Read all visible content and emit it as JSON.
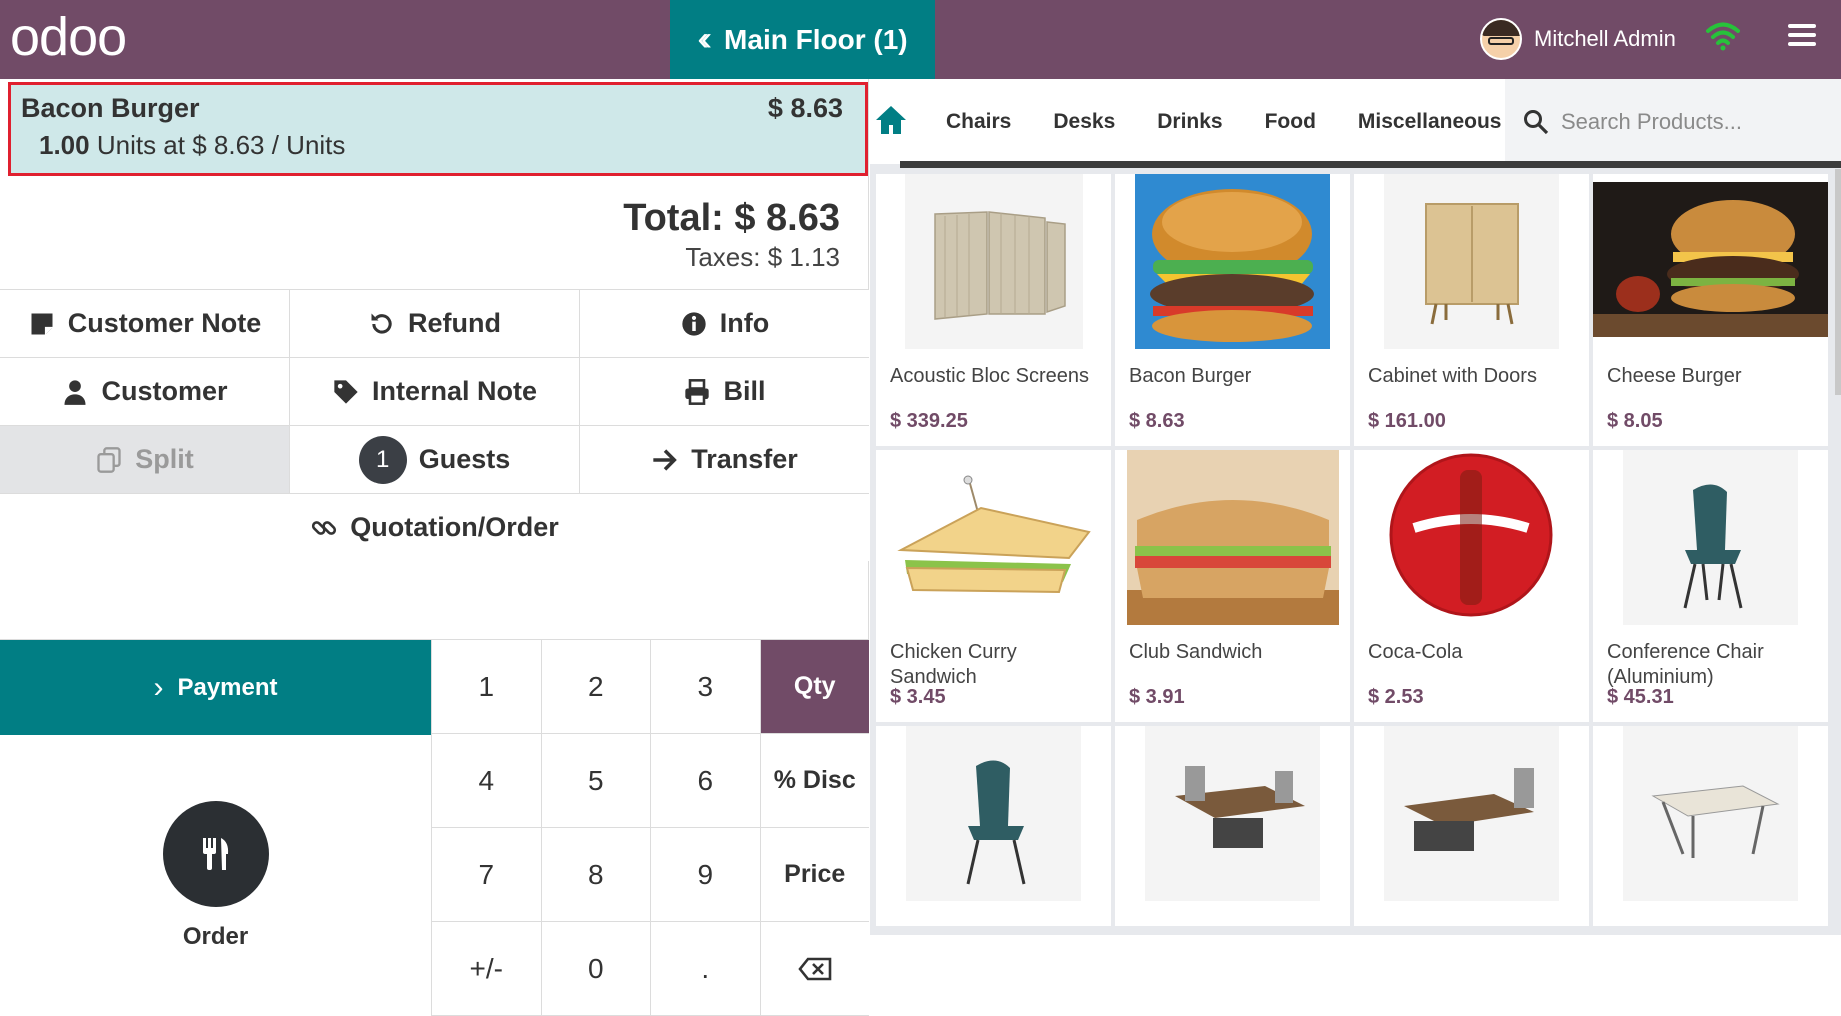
{
  "topbar": {
    "logo": "odoo",
    "floor_button": "Main Floor (1)",
    "user_name": "Mitchell Admin",
    "colors": {
      "brand": "#714B67",
      "teal": "#017E84"
    }
  },
  "order": {
    "line": {
      "name": "Bacon Burger",
      "price": "$ 8.63",
      "qty": "1.00",
      "qty_text": "Units at $ 8.63 / Units"
    },
    "total": "Total: $ 8.63",
    "taxes": "Taxes: $ 1.13"
  },
  "controls": {
    "customer_note": "Customer Note",
    "refund": "Refund",
    "info": "Info",
    "customer": "Customer",
    "internal_note": "Internal Note",
    "bill": "Bill",
    "split": "Split",
    "guests_count": "1",
    "guests": "Guests",
    "transfer": "Transfer",
    "quotation": "Quotation/Order"
  },
  "pad": {
    "payment": "Payment",
    "order": "Order",
    "keys": [
      "1",
      "2",
      "3",
      "Qty",
      "4",
      "5",
      "6",
      "% Disc",
      "7",
      "8",
      "9",
      "Price",
      "+/-",
      "0",
      "."
    ],
    "active_mode": "Qty"
  },
  "categories": [
    "Chairs",
    "Desks",
    "Drinks",
    "Food",
    "Miscellaneous"
  ],
  "search": {
    "placeholder": "Search Products..."
  },
  "products": [
    {
      "name": "Acoustic Bloc Screens",
      "price": "$ 339.25",
      "icon": "screen-image"
    },
    {
      "name": "Bacon Burger",
      "price": "$ 8.63",
      "icon": "burger-image"
    },
    {
      "name": "Cabinet with Doors",
      "price": "$ 161.00",
      "icon": "cabinet-image"
    },
    {
      "name": "Cheese Burger",
      "price": "$ 8.05",
      "icon": "burger-image"
    },
    {
      "name": "Chicken Curry Sandwich",
      "price": "$ 3.45",
      "icon": "sandwich-image"
    },
    {
      "name": "Club Sandwich",
      "price": "$ 3.91",
      "icon": "sandwich-image"
    },
    {
      "name": "Coca-Cola",
      "price": "$ 2.53",
      "icon": "cola-image"
    },
    {
      "name": "Conference Chair (Aluminium)",
      "price": "$ 45.31",
      "icon": "chair-image"
    }
  ]
}
